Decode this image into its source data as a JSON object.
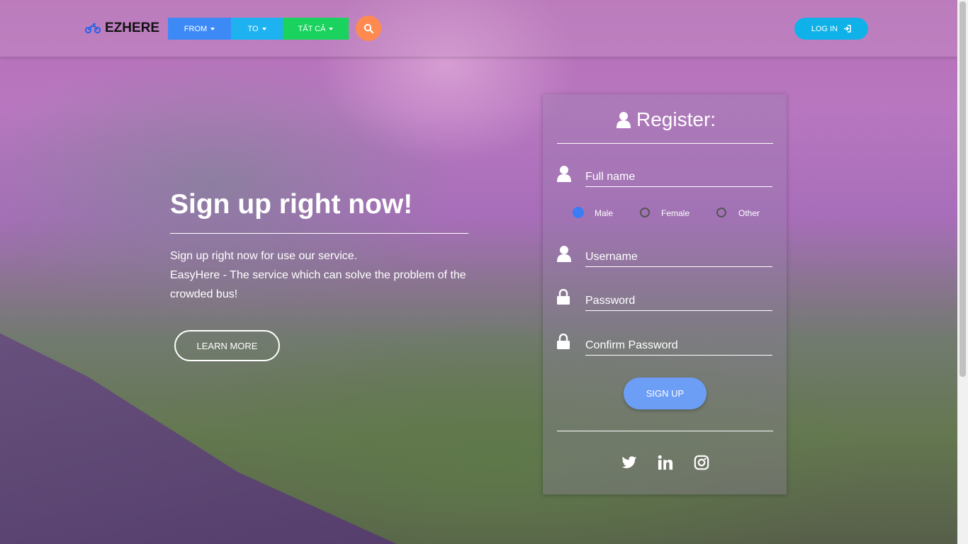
{
  "navbar": {
    "brand": "EZHERE",
    "brand_icon": "motorcycle-icon",
    "from_label": "FROM",
    "to_label": "TO",
    "all_label": "TẤT CẢ",
    "search_icon": "search-icon",
    "login_label": "LOG IN",
    "login_icon": "sign-in-icon",
    "colors": {
      "from": "#3d8af7",
      "to": "#1eb2f0",
      "all": "#1ad25e",
      "search": "#ff8a50",
      "login": "#0fb2e8"
    }
  },
  "hero": {
    "title": "Sign up right now!",
    "line1": "Sign up right now for use our service.",
    "line2": "EasyHere - The service which can solve the problem of the crowded bus!",
    "learn_more": "LEARN MORE"
  },
  "register": {
    "title": "Register:",
    "fullname_placeholder": "Full name",
    "gender_options": [
      "Male",
      "Female",
      "Other"
    ],
    "gender_selected": "Male",
    "username_placeholder": "Username",
    "password_placeholder": "Password",
    "confirm_placeholder": "Confirm Password",
    "signup_label": "SIGN UP",
    "social_icons": [
      "twitter-icon",
      "linkedin-icon",
      "instagram-icon"
    ]
  }
}
